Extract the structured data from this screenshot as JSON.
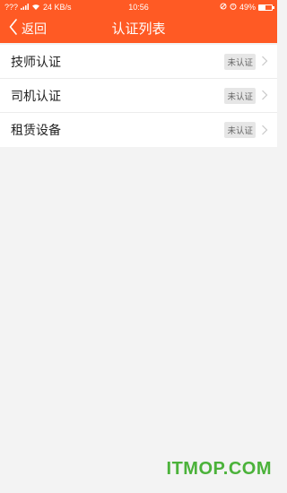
{
  "status_bar": {
    "carrier": "???",
    "network_speed": "24 KB/s",
    "time": "10:56",
    "battery_percent": "49%",
    "battery_level": 0.49
  },
  "nav": {
    "back_label": "返回",
    "title": "认证列表"
  },
  "list": {
    "items": [
      {
        "label": "技师认证",
        "status": "未认证"
      },
      {
        "label": "司机认证",
        "status": "未认证"
      },
      {
        "label": "租赁设备",
        "status": "未认证"
      }
    ]
  },
  "watermark": "ITMOP.COM",
  "colors": {
    "accent": "#ff5a24",
    "background": "#f3f3f3",
    "watermark": "#4bb23a"
  }
}
